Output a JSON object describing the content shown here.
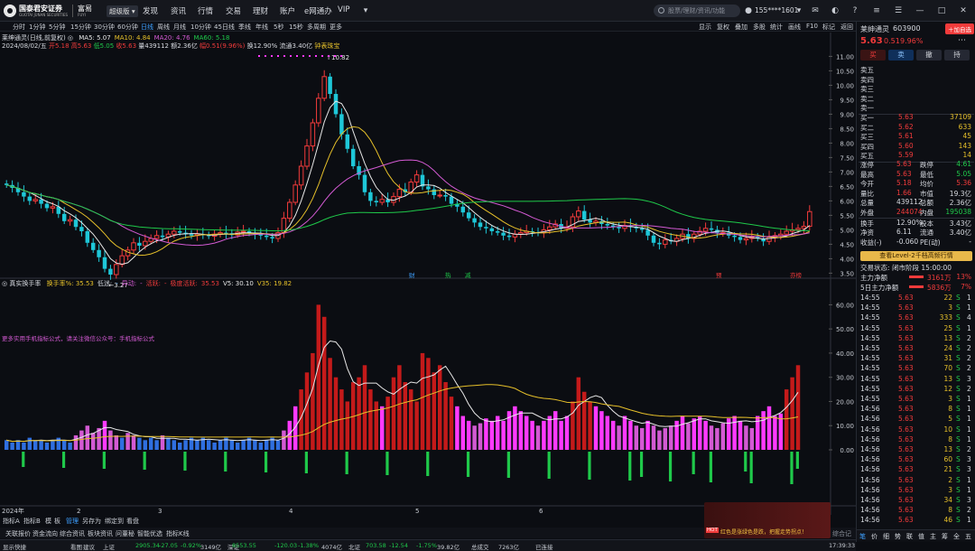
{
  "topbar": {
    "logo_name": "国泰君安证券",
    "logo_sub": "GUOTAI JUNAN SECURITIES",
    "app_name": "富易",
    "app_sub": "FUYI",
    "menu_button": "超级版",
    "nav": [
      "发现",
      "资讯",
      "行情",
      "交易",
      "理财",
      "账户",
      "e网通办",
      "VIP"
    ],
    "search_placeholder": "股票/理财/资讯/功能",
    "account": "155****1601",
    "icons": [
      "menu-icon",
      "user-icon",
      "message-icon",
      "chat-icon",
      "help-icon",
      "gear-icon",
      "minimize-icon",
      "maximize-icon",
      "close-icon"
    ]
  },
  "toolbar2": {
    "periods": [
      "分时",
      "1分钟",
      "5分钟",
      "15分钟",
      "30分钟",
      "60分钟",
      "日线",
      "周线",
      "月线",
      "10分钟",
      "45日线",
      "季线",
      "年线",
      "5秒",
      "15秒",
      "多周期",
      "更多"
    ],
    "selected": "日线",
    "right_tools": [
      "显示",
      "复权",
      "叠加",
      "多股",
      "统计",
      "画线",
      "F10",
      "标记",
      "返回"
    ]
  },
  "main_chart": {
    "title": "莱绅通灵(日线,前复权)",
    "ma_labels": [
      {
        "text": "MA5: 5.07",
        "color": "#e8e8e8"
      },
      {
        "text": "MA10: 4.84",
        "color": "#e6c02a"
      },
      {
        "text": "MA20: 4.76",
        "color": "#d35ad3"
      },
      {
        "text": "MA60: 5.18",
        "color": "#1fc94a"
      }
    ],
    "info_line": {
      "date": "2024/08/02/五",
      "open": "开5.18",
      "high": "高5.63",
      "low": "低5.05",
      "close": "收5.63",
      "volume": "量439112",
      "amount": "额2.36亿",
      "change": "幅0.51(9.96%)",
      "turnover": "换12.90%",
      "float_cap": "流通3.40亿",
      "tag": "钟表珠宝"
    },
    "high_label": "10.82",
    "low_label": "3.27",
    "event_markers": [
      {
        "text": "财",
        "color": "#3ea0ff"
      },
      {
        "text": "热",
        "color": "#1fc94a"
      },
      {
        "text": "减",
        "color": "#1fc94a"
      },
      {
        "text": "预",
        "color": "#f23b3b"
      },
      {
        "text": "亦榜",
        "color": "#f23b3b"
      }
    ],
    "price_axis": [
      "11.00",
      "10.50",
      "10.00",
      "9.50",
      "9.00",
      "8.50",
      "8.00",
      "7.50",
      "7.00",
      "6.50",
      "6.00",
      "5.50",
      "5.00",
      "4.50",
      "4.00",
      "3.50"
    ]
  },
  "sub_chart": {
    "title": "真实换手率",
    "items": [
      {
        "text": "换手率%: 35.53",
        "color": "#e6c02a"
      },
      {
        "text": "低迷:",
        "color": "#c9cdd4"
      },
      {
        "text": "-",
        "color": "#3ea0ff"
      },
      {
        "text": "异动:",
        "color": "#d35ad3"
      },
      {
        "text": "-",
        "color": "#d35ad3"
      },
      {
        "text": "活跃:",
        "color": "#f23b3b"
      },
      {
        "text": "-",
        "color": "#f23b3b"
      },
      {
        "text": "极度活跃:",
        "color": "#f23b3b"
      },
      {
        "text": "35.53",
        "color": "#f23b3b"
      },
      {
        "text": "V5: 30.10",
        "color": "#e8e8e8"
      },
      {
        "text": "V35: 19.82",
        "color": "#e6c02a"
      }
    ],
    "promo": "更多实用手机指标公式，请关注微信公众号：手机指标公式",
    "axis": [
      "60.00",
      "50.00",
      "40.00",
      "30.00",
      "20.00",
      "10.00",
      "0.00"
    ]
  },
  "date_axis": [
    "2024年",
    "2",
    "3",
    "4",
    "5",
    "6"
  ],
  "bottom_tabs": [
    "指标A",
    "指标B",
    "模",
    "板",
    "管理",
    "另存为",
    "绑定到",
    "看盘"
  ],
  "bottom_tabs2": [
    "关联报价",
    "资金流向",
    "综合资讯",
    "板块资讯",
    "问董秘",
    "智能优选",
    "指标K线"
  ],
  "statusbar": {
    "show_fast": "显示快捷",
    "items": [
      {
        "text": "看图",
        "color": "#c9cdd4"
      },
      {
        "text": "建议",
        "color": "#c9cdd4"
      },
      {
        "text": "上证",
        "color": "#c9cdd4"
      },
      {
        "text": "2905.34",
        "color": "#1fc94a"
      },
      {
        "text": "-27.05",
        "color": "#1fc94a"
      },
      {
        "text": "-0.92%",
        "color": "#1fc94a"
      },
      {
        "text": "3149亿",
        "color": "#c9cdd4"
      },
      {
        "text": "深证",
        "color": "#c9cdd4"
      },
      {
        "text": "8553.55",
        "color": "#1fc94a"
      },
      {
        "text": "-120.03",
        "color": "#1fc94a"
      },
      {
        "text": "-1.38%",
        "color": "#1fc94a"
      },
      {
        "text": "4074亿",
        "color": "#c9cdd4"
      },
      {
        "text": "北证",
        "color": "#c9cdd4"
      },
      {
        "text": "703.58",
        "color": "#1fc94a"
      },
      {
        "text": "-12.54",
        "color": "#1fc94a"
      },
      {
        "text": "-1.75%",
        "color": "#1fc94a"
      },
      {
        "text": "39.82亿",
        "color": "#c9cdd4"
      },
      {
        "text": "总成交",
        "color": "#c9cdd4"
      },
      {
        "text": "7263亿",
        "color": "#c9cdd4"
      },
      {
        "text": "已连接",
        "color": "#c9cdd4"
      }
    ],
    "promo": "红色是涨绿色是跌，把握走势拐点！",
    "promo_tag": "HOT",
    "right_label": "综合记忆",
    "time": "17:39:33"
  },
  "rpanel": {
    "stock_name": "莱绅通灵",
    "stock_code": "603900",
    "price": "5.63",
    "change": "0.51",
    "pct": "9.96%",
    "add_label": "加自选",
    "buttons": [
      "买",
      "卖",
      "撤",
      "持"
    ],
    "sell_levels": [
      "卖五",
      "卖四",
      "卖三",
      "卖二",
      "卖一"
    ],
    "buy_levels": [
      {
        "label": "买一",
        "price": "5.63",
        "vol": "37109"
      },
      {
        "label": "买二",
        "price": "5.62",
        "vol": "633"
      },
      {
        "label": "买三",
        "price": "5.61",
        "vol": "45"
      },
      {
        "label": "买四",
        "price": "5.60",
        "vol": "143"
      },
      {
        "label": "买五",
        "price": "5.59",
        "vol": "14"
      }
    ],
    "stats": [
      {
        "l1": "涨停",
        "v1": "5.63",
        "c1": "#f23b3b",
        "l2": "跌停",
        "v2": "4.61",
        "c2": "#1fc94a"
      },
      {
        "l1": "最高",
        "v1": "5.63",
        "c1": "#f23b3b",
        "l2": "最低",
        "v2": "5.05",
        "c2": "#1fc94a"
      },
      {
        "l1": "今开",
        "v1": "5.18",
        "c1": "#f23b3b",
        "l2": "均价",
        "v2": "5.36",
        "c2": "#f23b3b"
      },
      {
        "l1": "量比",
        "v1": "1.66",
        "c1": "#f23b3b",
        "l2": "市值",
        "v2": "19.3亿",
        "c2": "#d7dae0"
      },
      {
        "l1": "总量",
        "v1": "439112",
        "c1": "#d7dae0",
        "l2": "总额",
        "v2": "2.36亿",
        "c2": "#d7dae0"
      },
      {
        "l1": "外盘",
        "v1": "244074",
        "c1": "#f23b3b",
        "l2": "内盘",
        "v2": "195038",
        "c2": "#1fc94a"
      },
      {
        "l1": "换手",
        "v1": "12.90%",
        "c1": "#d7dae0",
        "l2": "股本",
        "v2": "3.43亿",
        "c2": "#d7dae0"
      },
      {
        "l1": "净资",
        "v1": "6.11",
        "c1": "#d7dae0",
        "l2": "流通",
        "v2": "3.40亿",
        "c2": "#d7dae0"
      },
      {
        "l1": "收益(-)",
        "v1": "-0.060",
        "c1": "#d7dae0",
        "l2": "PE(动)",
        "v2": "-",
        "c2": "#d7dae0"
      }
    ],
    "level2_banner": "查看Level-2千档高频行情",
    "trade_status_label": "交易状态:",
    "trade_status": "闭市阶段 15:00:00",
    "flow": [
      {
        "label": "主力净额",
        "value": "3161万",
        "pct": "13%"
      },
      {
        "label": "5日主力净额",
        "value": "5836万",
        "pct": "7%"
      }
    ],
    "ticks": [
      {
        "t": "14:55",
        "p": "5.63",
        "v": "22",
        "s": "S",
        "n": "1"
      },
      {
        "t": "14:55",
        "p": "5.63",
        "v": "3",
        "s": "S",
        "n": "1"
      },
      {
        "t": "14:55",
        "p": "5.63",
        "v": "333",
        "s": "S",
        "n": "4"
      },
      {
        "t": "14:55",
        "p": "5.63",
        "v": "25",
        "s": "S",
        "n": "1"
      },
      {
        "t": "14:55",
        "p": "5.63",
        "v": "13",
        "s": "S",
        "n": "2"
      },
      {
        "t": "14:55",
        "p": "5.63",
        "v": "24",
        "s": "S",
        "n": "2"
      },
      {
        "t": "14:55",
        "p": "5.63",
        "v": "31",
        "s": "S",
        "n": "2"
      },
      {
        "t": "14:55",
        "p": "5.63",
        "v": "70",
        "s": "S",
        "n": "2"
      },
      {
        "t": "14:55",
        "p": "5.63",
        "v": "13",
        "s": "S",
        "n": "3"
      },
      {
        "t": "14:55",
        "p": "5.63",
        "v": "12",
        "s": "S",
        "n": "2"
      },
      {
        "t": "14:55",
        "p": "5.63",
        "v": "3",
        "s": "S",
        "n": "1"
      },
      {
        "t": "14:56",
        "p": "5.63",
        "v": "8",
        "s": "S",
        "n": "1"
      },
      {
        "t": "14:56",
        "p": "5.63",
        "v": "5",
        "s": "S",
        "n": "1"
      },
      {
        "t": "14:56",
        "p": "5.63",
        "v": "10",
        "s": "S",
        "n": "1"
      },
      {
        "t": "14:56",
        "p": "5.63",
        "v": "8",
        "s": "S",
        "n": "1"
      },
      {
        "t": "14:56",
        "p": "5.63",
        "v": "13",
        "s": "S",
        "n": "2"
      },
      {
        "t": "14:56",
        "p": "5.63",
        "v": "60",
        "s": "S",
        "n": "3"
      },
      {
        "t": "14:56",
        "p": "5.63",
        "v": "21",
        "s": "S",
        "n": "3"
      },
      {
        "t": "14:56",
        "p": "5.63",
        "v": "2",
        "s": "S",
        "n": "1"
      },
      {
        "t": "14:56",
        "p": "5.63",
        "v": "3",
        "s": "S",
        "n": "1"
      },
      {
        "t": "14:56",
        "p": "5.63",
        "v": "34",
        "s": "S",
        "n": "3"
      },
      {
        "t": "14:56",
        "p": "5.63",
        "v": "8",
        "s": "S",
        "n": "2"
      },
      {
        "t": "14:56",
        "p": "5.63",
        "v": "46",
        "s": "S",
        "n": "1"
      }
    ],
    "bottom_tabs": [
      "笔",
      "价",
      "细",
      "势",
      "联",
      "值",
      "主",
      "筹",
      "全",
      "五"
    ],
    "bottom_icons": [
      "list-icon",
      "up-icon",
      "close-icon",
      "down-icon"
    ]
  },
  "chart_data": {
    "type": "candlestick",
    "x": [
      "2024-01-02",
      "2024-01-03",
      "2024-01-04",
      "2024-01-05",
      "2024-01-08",
      "2024-01-09",
      "2024-01-10",
      "2024-01-11",
      "2024-01-12",
      "2024-01-15",
      "2024-01-16",
      "2024-01-17",
      "2024-01-18",
      "2024-01-19",
      "2024-01-22",
      "2024-01-23",
      "2024-01-24",
      "2024-01-25",
      "2024-01-26",
      "2024-01-29",
      "2024-01-30",
      "2024-01-31",
      "2024-02-01",
      "2024-02-02",
      "2024-02-05",
      "2024-02-06",
      "2024-02-07",
      "2024-02-08",
      "2024-02-19",
      "2024-02-20",
      "2024-02-21",
      "2024-02-22",
      "2024-02-23",
      "2024-02-26",
      "2024-02-27",
      "2024-02-28",
      "2024-02-29",
      "2024-03-01",
      "2024-03-04",
      "2024-03-05",
      "2024-03-06",
      "2024-03-07",
      "2024-03-08",
      "2024-03-11",
      "2024-03-12",
      "2024-03-13",
      "2024-03-14",
      "2024-03-15",
      "2024-03-18",
      "2024-03-19",
      "2024-03-20",
      "2024-03-21",
      "2024-03-22",
      "2024-03-25",
      "2024-03-26",
      "2024-03-27",
      "2024-03-28",
      "2024-03-29",
      "2024-04-01",
      "2024-04-02",
      "2024-04-03",
      "2024-04-08",
      "2024-04-09",
      "2024-04-10",
      "2024-04-11",
      "2024-04-12",
      "2024-04-15",
      "2024-04-16",
      "2024-04-17",
      "2024-04-18",
      "2024-04-19",
      "2024-04-22",
      "2024-04-23",
      "2024-04-24",
      "2024-04-25",
      "2024-04-26",
      "2024-04-29",
      "2024-04-30",
      "2024-05-06",
      "2024-05-07",
      "2024-05-08",
      "2024-05-09",
      "2024-05-10",
      "2024-05-13",
      "2024-05-14",
      "2024-05-15",
      "2024-05-16",
      "2024-05-17",
      "2024-05-20",
      "2024-05-21",
      "2024-05-22",
      "2024-05-23",
      "2024-05-24",
      "2024-05-27",
      "2024-05-28",
      "2024-05-29",
      "2024-05-30",
      "2024-05-31",
      "2024-06-03",
      "2024-06-04",
      "2024-06-05",
      "2024-06-06",
      "2024-06-07",
      "2024-06-11",
      "2024-06-12",
      "2024-06-13",
      "2024-06-14",
      "2024-06-17",
      "2024-06-18",
      "2024-06-19",
      "2024-06-20",
      "2024-06-21",
      "2024-06-24",
      "2024-06-25",
      "2024-06-26",
      "2024-06-27",
      "2024-06-28",
      "2024-07-01",
      "2024-07-02",
      "2024-07-03",
      "2024-07-04",
      "2024-07-05",
      "2024-07-08",
      "2024-07-09",
      "2024-07-10",
      "2024-07-11",
      "2024-07-12",
      "2024-07-15",
      "2024-07-16",
      "2024-07-17",
      "2024-07-18",
      "2024-07-19",
      "2024-07-22",
      "2024-07-23",
      "2024-07-24",
      "2024-07-25",
      "2024-07-26",
      "2024-07-29",
      "2024-07-30",
      "2024-07-31",
      "2024-08-01",
      "2024-08-02"
    ],
    "close": [
      6.55,
      6.45,
      6.3,
      6.15,
      6.0,
      6.05,
      5.9,
      5.75,
      5.8,
      5.55,
      5.3,
      5.35,
      5.1,
      4.95,
      4.55,
      4.3,
      4.05,
      3.65,
      3.45,
      3.8,
      4.1,
      4.3,
      4.55,
      4.45,
      4.6,
      4.7,
      4.8,
      4.75,
      4.85,
      4.95,
      4.9,
      4.85,
      4.8,
      4.85,
      4.82,
      4.78,
      4.85,
      4.9,
      4.88,
      4.82,
      4.92,
      4.95,
      4.9,
      4.85,
      4.8,
      4.75,
      4.7,
      4.9,
      5.4,
      5.95,
      6.55,
      7.2,
      7.9,
      8.7,
      9.55,
      10.3,
      9.7,
      9.0,
      8.3,
      7.8,
      7.2,
      6.9,
      6.3,
      6.0,
      5.95,
      6.05,
      5.95,
      6.15,
      6.4,
      6.3,
      6.65,
      6.9,
      6.5,
      6.4,
      6.2,
      6.2,
      6.15,
      5.9,
      5.8,
      5.6,
      5.4,
      5.25,
      5.1,
      5.05,
      4.95,
      4.9,
      4.8,
      4.75,
      4.85,
      4.9,
      4.95,
      4.92,
      4.9,
      5.0,
      5.1,
      5.2,
      5.05,
      5.1,
      5.45,
      5.65,
      5.35,
      5.25,
      5.3,
      5.2,
      5.15,
      5.1,
      5.05,
      5.15,
      5.1,
      5.05,
      5.0,
      4.8,
      4.55,
      4.5,
      4.65,
      4.6,
      4.7,
      4.85,
      4.7,
      4.85,
      4.95,
      5.05,
      5.0,
      4.9,
      4.9,
      4.8,
      4.75,
      4.65,
      4.7,
      4.75,
      4.7,
      4.6,
      4.75,
      4.8,
      4.85,
      4.95,
      5.0,
      5.05,
      5.12,
      5.63
    ],
    "ma": [
      {
        "name": "MA5",
        "last": 5.07,
        "color": "#e8e8e8"
      },
      {
        "name": "MA10",
        "last": 4.84,
        "color": "#e6c02a"
      },
      {
        "name": "MA20",
        "last": 4.76,
        "color": "#d35ad3"
      },
      {
        "name": "MA60",
        "last": 5.18,
        "color": "#1fc94a"
      }
    ],
    "ylim": [
      3.2,
      11.2
    ],
    "high": 10.82,
    "low": 3.27,
    "turnover": [
      4,
      3,
      4,
      3,
      5,
      4,
      4,
      3,
      4,
      5,
      4,
      3,
      6,
      8,
      10,
      7,
      9,
      12,
      8,
      6,
      5,
      7,
      6,
      5,
      4,
      5,
      4,
      6,
      5,
      4,
      3,
      4,
      5,
      4,
      5,
      4,
      3,
      4,
      5,
      4,
      3,
      4,
      5,
      4,
      3,
      4,
      5,
      4,
      8,
      12,
      18,
      25,
      32,
      40,
      60,
      55,
      38,
      30,
      25,
      20,
      28,
      30,
      35,
      25,
      20,
      18,
      22,
      30,
      35,
      28,
      25,
      20,
      40,
      38,
      32,
      35,
      28,
      22,
      18,
      14,
      12,
      10,
      11,
      13,
      12,
      14,
      12,
      16,
      18,
      16,
      14,
      12,
      10,
      12,
      14,
      16,
      12,
      14,
      20,
      30,
      24,
      20,
      18,
      16,
      14,
      12,
      10,
      14,
      12,
      10,
      9,
      12,
      10,
      8,
      9,
      10,
      12,
      14,
      11,
      13,
      14,
      12,
      10,
      9,
      11,
      13,
      14,
      12,
      10,
      9,
      14,
      16,
      18,
      14,
      15,
      25,
      30,
      35
    ],
    "turnover_v5_last": 30.1,
    "turnover_v35_last": 19.82,
    "sub_ylim": [
      0,
      65
    ]
  }
}
